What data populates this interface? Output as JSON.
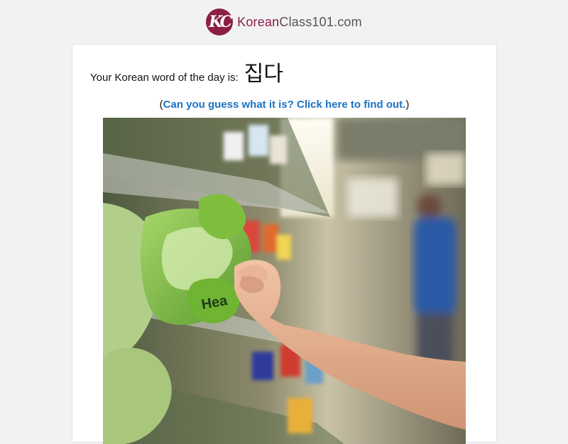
{
  "header": {
    "logo_mark": "KC",
    "brand_prefix": "Korean",
    "brand_suffix": "Class101.com"
  },
  "wotd": {
    "label": "Your Korean word of the day is:",
    "word": "집다"
  },
  "guess": {
    "open_paren": "(",
    "link_text": "Can you guess what it is? Click here to find out.",
    "close_paren": ")"
  },
  "image": {
    "label_on_bag": "Hea"
  },
  "colors": {
    "brand": "#8a1e45",
    "link": "#1a73c4",
    "background": "#f2f2f4"
  }
}
